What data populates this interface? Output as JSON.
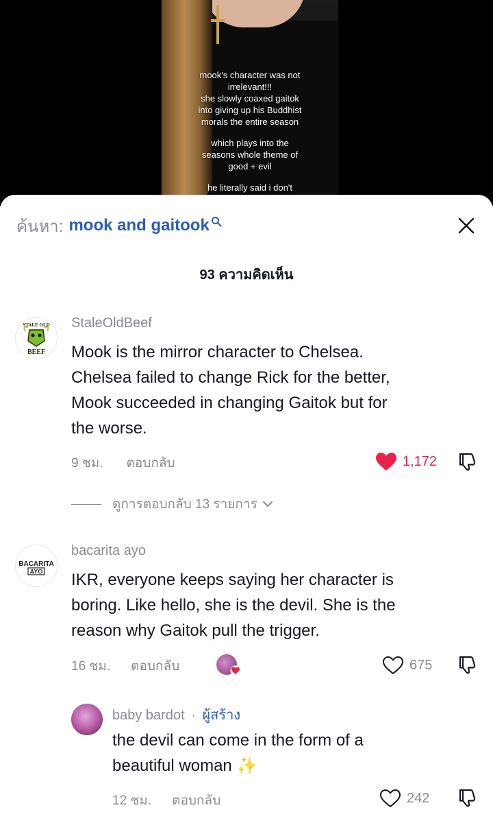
{
  "video": {
    "caption_lines": [
      "mook's character was not",
      "irrelevant!!!",
      "she slowly coaxed gaitok",
      "into giving up his Buddhist",
      "morals the entire season",
      "",
      "which plays into the",
      "seasons whole theme of",
      "good + evil",
      "",
      "he literally said i don't"
    ]
  },
  "search": {
    "prefix": "ค้นหา:",
    "term": "mook and gaitook",
    "icon": "search-icon"
  },
  "close_icon": "close-icon",
  "comment_count": "93 ความคิดเห็น",
  "comments": [
    {
      "username": "StaleOldBeef",
      "avatar_text": [
        "STALE OLD",
        "BEEF"
      ],
      "text_lines": [
        "Mook is the mirror character to Chelsea.",
        "Chelsea failed to change Rick for the better,",
        "Mook succeeded in changing Gaitok but for",
        "the worse."
      ],
      "time": "9 ชม.",
      "reply_label": "ตอบกลับ",
      "likes": "1,172",
      "liked": true,
      "view_replies": "ดูการตอบกลับ 13 รายการ"
    },
    {
      "username": "bacarita ayo",
      "avatar_text": [
        "BACARITA",
        "AYO"
      ],
      "text_lines": [
        "IKR, everyone keeps saying her character is",
        "boring. Like hello, she is the devil. She is the",
        "reason why Gaitok pull the trigger."
      ],
      "time": "16 ชม.",
      "reply_label": "ตอบกลับ",
      "likes": "675",
      "liked": false
    },
    {
      "username": "baby bardot",
      "creator_sep": "·",
      "creator_label": "ผู้สร้าง",
      "text_lines": [
        "the devil can come in the form of a",
        "beautiful woman ✨"
      ],
      "time": "12 ชม.",
      "reply_label": "ตอบกลับ",
      "likes": "242",
      "liked": false
    }
  ],
  "colors": {
    "accent_blue": "#2b5db8",
    "like_red": "#e8224a",
    "muted": "#8a8b91",
    "text": "#161823"
  }
}
